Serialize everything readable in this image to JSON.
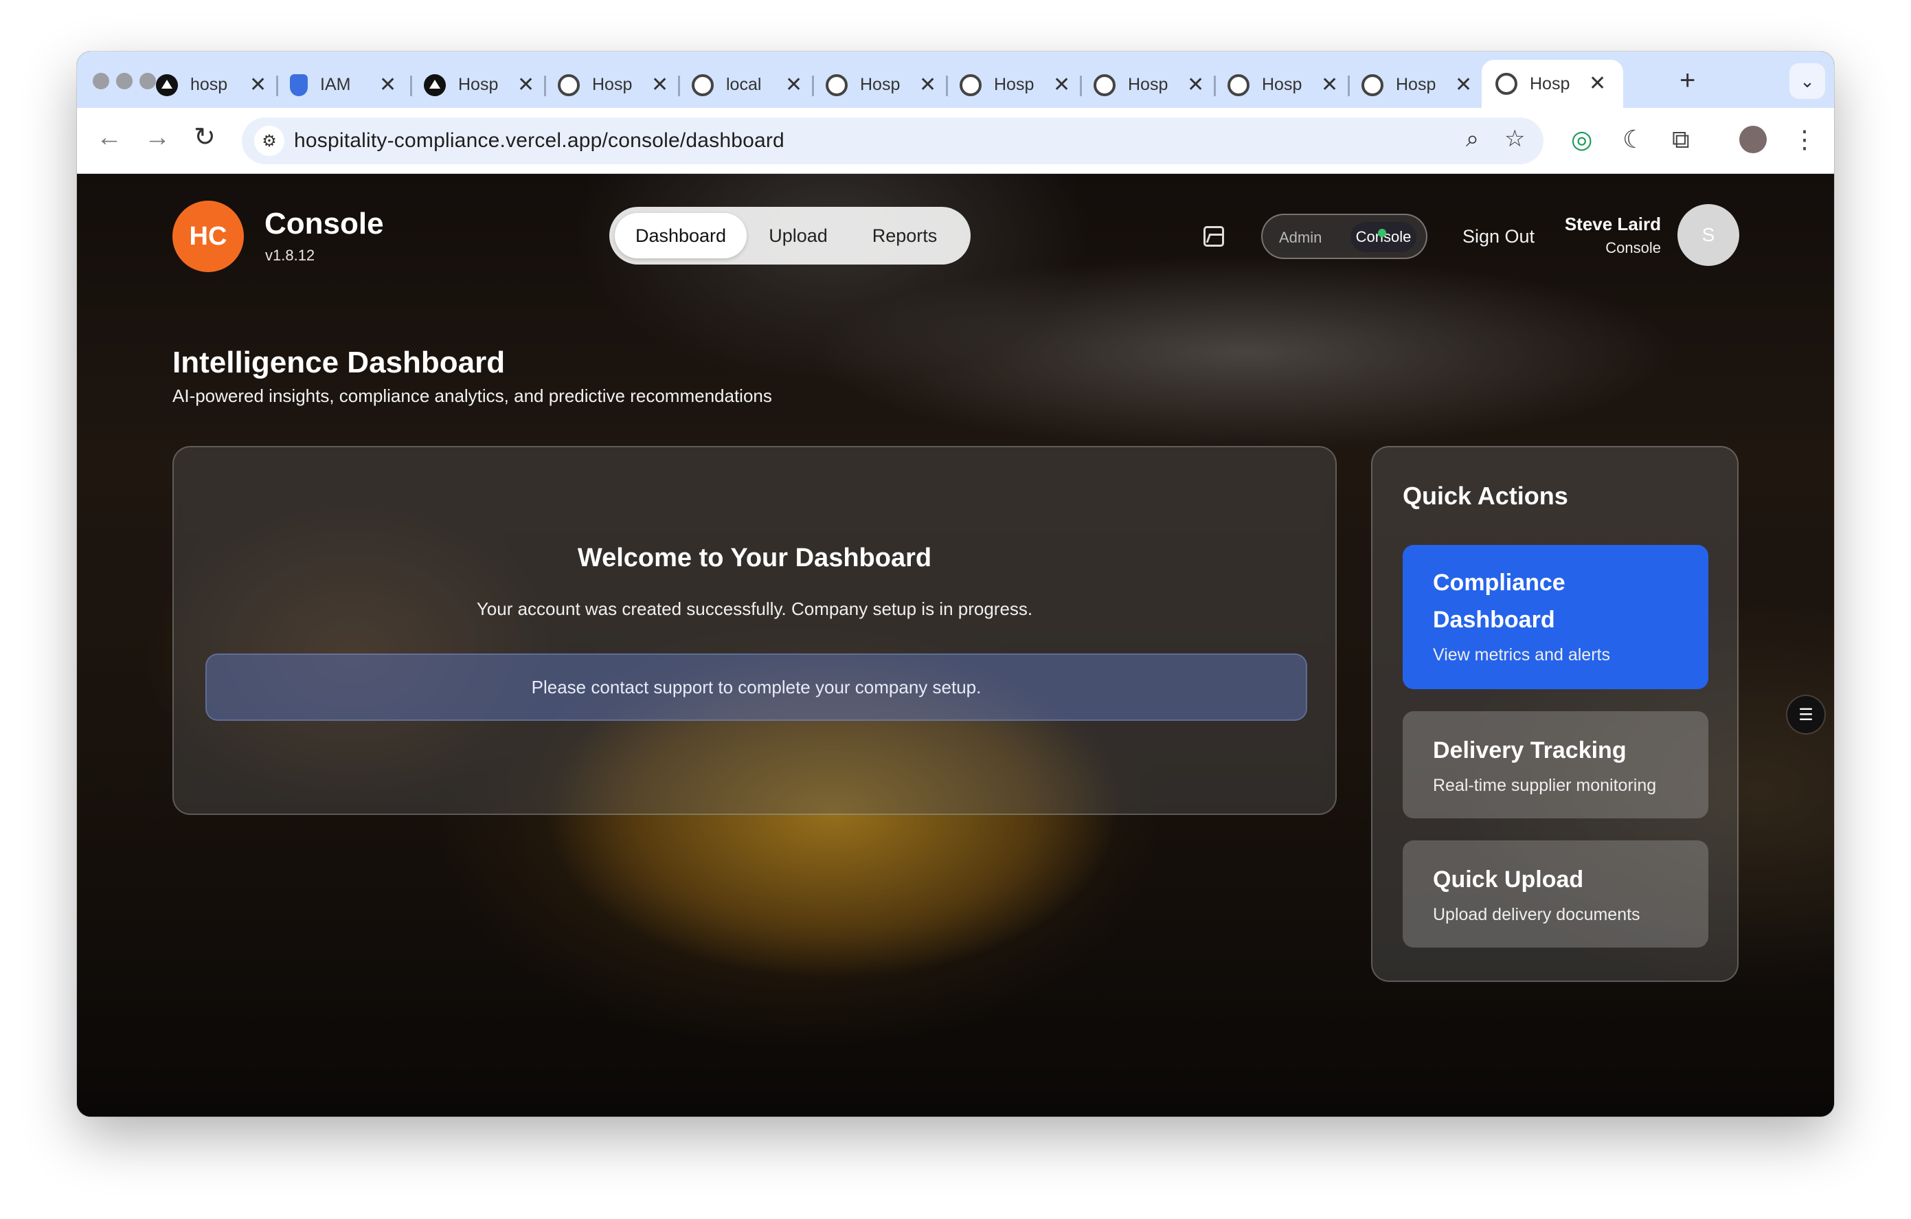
{
  "browser": {
    "tabs": [
      {
        "label": "hosp",
        "icon": "vercel-icon"
      },
      {
        "label": "IAM",
        "icon": "shield-icon"
      },
      {
        "label": "Hosp",
        "icon": "vercel-icon"
      },
      {
        "label": "Hosp",
        "icon": "globe-icon"
      },
      {
        "label": "local",
        "icon": "globe-icon"
      },
      {
        "label": "Hosp",
        "icon": "globe-icon"
      },
      {
        "label": "Hosp",
        "icon": "globe-icon"
      },
      {
        "label": "Hosp",
        "icon": "globe-icon"
      },
      {
        "label": "Hosp",
        "icon": "globe-icon"
      },
      {
        "label": "Hosp",
        "icon": "globe-icon"
      },
      {
        "label": "Hosp",
        "icon": "globe-icon",
        "active": true
      }
    ],
    "tab_close": "✕",
    "new_tab": "+",
    "url": "hospitality-compliance.vercel.app/console/dashboard"
  },
  "header": {
    "logo": "HC",
    "brand": "Console",
    "version": "v1.8.12",
    "nav": [
      "Dashboard",
      "Upload",
      "Reports"
    ],
    "mode_admin": "Admin",
    "mode_console": "Console",
    "sign_out": "Sign Out",
    "user_name": "Steve Laird",
    "user_role": "Console",
    "avatar_initial": "S"
  },
  "page": {
    "title": "Intelligence Dashboard",
    "subtitle": "AI-powered insights, compliance analytics, and predictive recommendations"
  },
  "welcome": {
    "title": "Welcome to Your Dashboard",
    "message": "Your account was created successfully. Company setup is in progress.",
    "notice": "Please contact support to complete your company setup."
  },
  "quick_actions": {
    "title": "Quick Actions",
    "items": [
      {
        "title": "Compliance Dashboard",
        "desc": "View metrics and alerts"
      },
      {
        "title": "Delivery Tracking",
        "desc": "Real-time supplier monitoring"
      },
      {
        "title": "Quick Upload",
        "desc": "Upload delivery documents"
      }
    ]
  },
  "colors": {
    "accent": "#2563eb",
    "logo": "#f36b21",
    "tabstrip": "#d3e3fd"
  }
}
